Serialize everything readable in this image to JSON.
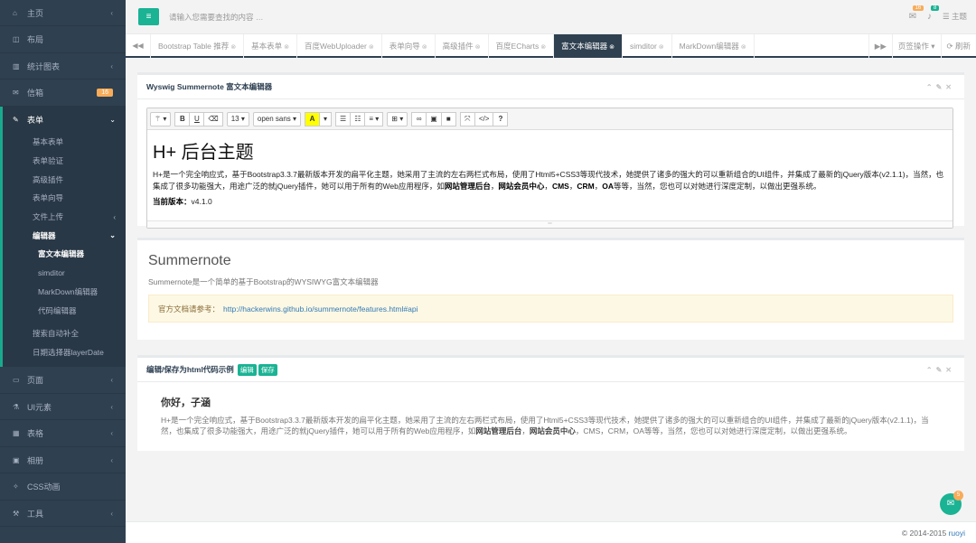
{
  "sidebar": {
    "items": [
      {
        "icon": "home-icon",
        "glyph": "⌂",
        "label": "主页",
        "arrow": "‹"
      },
      {
        "icon": "columns-icon",
        "glyph": "◫",
        "label": "布局"
      },
      {
        "icon": "bar-chart-icon",
        "glyph": "▥",
        "label": "统计图表",
        "arrow": "‹"
      },
      {
        "icon": "envelope-icon",
        "glyph": "✉",
        "label": "信箱",
        "badge": "16"
      }
    ],
    "form": {
      "label": "表单",
      "glyph": "✎",
      "arrow": "⌄",
      "subs": [
        "基本表单",
        "表单验证",
        "高级插件",
        "表单向导"
      ],
      "upload": "文件上传",
      "editor": "编辑器",
      "editor_subs": [
        "富文本编辑器",
        "simditor",
        "MarkDown编辑器",
        "代码编辑器"
      ],
      "extra": [
        "搜索自动补全",
        "日期选择器layerDate"
      ]
    },
    "items2": [
      {
        "icon": "desktop-icon",
        "glyph": "▭",
        "label": "页面",
        "arrow": "‹"
      },
      {
        "icon": "flask-icon",
        "glyph": "⚗",
        "label": "UI元素",
        "arrow": "‹"
      },
      {
        "icon": "table-icon",
        "glyph": "▦",
        "label": "表格",
        "arrow": "‹"
      },
      {
        "icon": "picture-icon",
        "glyph": "▣",
        "label": "相册",
        "arrow": "‹"
      },
      {
        "icon": "magic-icon",
        "glyph": "✧",
        "label": "CSS动画"
      },
      {
        "icon": "tools-icon",
        "glyph": "⚒",
        "label": "工具",
        "arrow": "‹"
      }
    ]
  },
  "topbar": {
    "search_placeholder": "请输入您需要查找的内容 …",
    "msg_badge": "16",
    "bell_badge": "8",
    "theme": "主题"
  },
  "tabs": [
    "Bootstrap Table 推荐",
    "基本表单",
    "百度WebUploader",
    "表单向导",
    "高级插件",
    "百度ECharts",
    "富文本编辑器",
    "simditor",
    "MarkDown编辑器"
  ],
  "tab_right": {
    "ops": "页签操作 ▾",
    "refresh": "⟳ 刷新"
  },
  "editor_box": {
    "title": "Wyswig Summernote 富文本编辑器",
    "toolbar": {
      "font_size": "13 ▾",
      "font_name": "open sans ▾"
    },
    "h1": "H+ 后台主题",
    "p1": "H+是一个完全响应式，基于Bootstrap3.3.7最新版本开发的扁平化主题，她采用了主流的左右两栏式布局，使用了Html5+CSS3等现代技术，她提供了诸多的强大的可以重新组合的UI组件，并集成了最新的jQuery版本(v2.1.1)，当然，也集成了很多功能强大，用途广泛的就jQuery插件，她可以用于所有的Web应用程序，如",
    "b1": "网站管理后台",
    "s1": "，",
    "b2": "网站会员中心",
    "s2": "，",
    "b3": "CMS",
    "s3": "，",
    "b4": "CRM",
    "s4": "，",
    "b5": "OA",
    "p1_end": "等等，当然，您也可以对她进行深度定制，以做出更强系统。",
    "version_label": "当前版本：",
    "version": "v4.1.0"
  },
  "summernote_box": {
    "title": "Summernote",
    "desc": "Summernote是一个简单的基于Bootstrap的WYSIWYG富文本编辑器",
    "doc_label": "官方文档请参考：",
    "doc_link": "http://hackerwins.github.io/summernote/features.html#api"
  },
  "html_box": {
    "title": "编辑/保存为html代码示例",
    "edit_btn": "编辑",
    "save_btn": "保存",
    "hello": "你好，子涵",
    "p1": "H+是一个完全响应式，基于Bootstrap3.3.7最新版本开发的扁平化主题，她采用了主流的左右两栏式布局，使用了Html5+CSS3等现代技术，她提供了诸多的强大的可以重新组合的UI组件，并集成了最新的jQuery版本(v2.1.1)，当然，也集成了很多功能强大，用途广泛的就jQuery插件，她可以用于所有的Web应用程序，如",
    "b1": "网站管理后台",
    "s1": "，",
    "b2": "网站会员中心",
    "p_end": "，CMS，CRM，OA等等，当然，您也可以对她进行深度定制，以做出更强系统。"
  },
  "footer": {
    "copy": "© 2014-2015 ",
    "author": "ruoyi"
  },
  "chat_badge": "5"
}
